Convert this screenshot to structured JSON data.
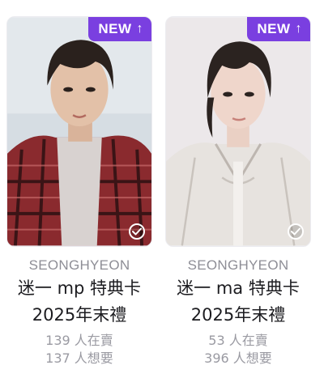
{
  "cards": [
    {
      "badge": "NEW",
      "badge_icon": "arrow-up-icon",
      "brand": "SEONGHYEON",
      "title_line1": "迷一 mp 特典卡",
      "title_line2": "2025年末禮",
      "sellers": "139 人在賣",
      "wanted": "137 人想要",
      "photo_desc_colors": {
        "bg": "#d6dde3",
        "shirt": "#8a2a2e",
        "hair": "#2a211d"
      }
    },
    {
      "badge": "NEW",
      "badge_icon": "arrow-up-icon",
      "brand": "SEONGHYEON",
      "title_line1": "迷一 ma 特典卡",
      "title_line2": "2025年末禮",
      "sellers": "53 人在賣",
      "wanted": "396 人想要",
      "photo_desc_colors": {
        "bg": "#ece8ea",
        "shirt": "#e7e3df",
        "hair": "#2b2320"
      }
    }
  ],
  "colors": {
    "accent": "#7a3fe0",
    "brand_text": "#8e8e96",
    "title_text": "#1c1c20",
    "stat_text": "#9a9aa2"
  }
}
